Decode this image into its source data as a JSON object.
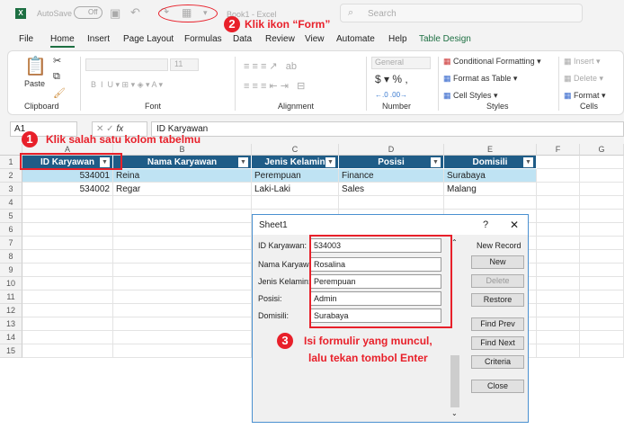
{
  "titlebar": {
    "autosave": "AutoSave",
    "toggle": "Off",
    "title": "Book1 - Excel",
    "search_placeholder": "Search"
  },
  "tabs": [
    "File",
    "Home",
    "Insert",
    "Page Layout",
    "Formulas",
    "Data",
    "Review",
    "View",
    "Automate",
    "Help",
    "Table Design"
  ],
  "ribbon": {
    "paste": "Paste",
    "clipboard": "Clipboard",
    "font": "Font",
    "font_size": "11",
    "alignment": "Alignment",
    "number_format": "General",
    "number": "Number",
    "cond_format": "Conditional Formatting",
    "format_table": "Format as Table",
    "cell_styles": "Cell Styles",
    "styles": "Styles",
    "insert": "Insert",
    "delete": "Delete",
    "format": "Format",
    "cells": "Cells"
  },
  "formula_bar": {
    "name_box": "A1",
    "fx": "fx",
    "value": "ID Karyawan"
  },
  "columns": [
    "A",
    "B",
    "C",
    "D",
    "E",
    "F",
    "G"
  ],
  "rows": [
    "1",
    "2",
    "3",
    "4",
    "5",
    "6",
    "7",
    "8",
    "9",
    "10",
    "11",
    "12",
    "13",
    "14",
    "15"
  ],
  "table": {
    "headers": [
      "ID Karyawan",
      "Nama Karyawan",
      "Jenis Kelamin",
      "Posisi",
      "Domisili"
    ],
    "data": [
      [
        "534001",
        "Reina",
        "Perempuan",
        "Finance",
        "Surabaya"
      ],
      [
        "534002",
        "Regar",
        "Laki-Laki",
        "Sales",
        "Malang"
      ]
    ]
  },
  "dialog": {
    "title": "Sheet1",
    "help": "?",
    "close": "✕",
    "record_status": "New Record",
    "fields": [
      {
        "label": "ID Karyawan:",
        "value": "534003"
      },
      {
        "label": "Nama Karyawan:",
        "value": "Rosalina"
      },
      {
        "label": "Jenis Kelamin:",
        "value": "Perempuan"
      },
      {
        "label": "Posisi:",
        "value": "Admin"
      },
      {
        "label": "Domisili:",
        "value": "Surabaya"
      }
    ],
    "buttons": [
      "New",
      "Delete",
      "Restore",
      "Find Prev",
      "Find Next",
      "Criteria",
      "Close"
    ]
  },
  "annotations": {
    "n1": "1",
    "t1": "Klik salah satu kolom tabelmu",
    "n2": "2",
    "t2": "Klik ikon “Form”",
    "n3": "3",
    "t3a": "Isi formulir yang muncul,",
    "t3b": "lalu tekan tombol Enter"
  },
  "colors": {
    "accent": "#1f5c87",
    "annotation": "#e8202a",
    "excel": "#1d6f42"
  }
}
